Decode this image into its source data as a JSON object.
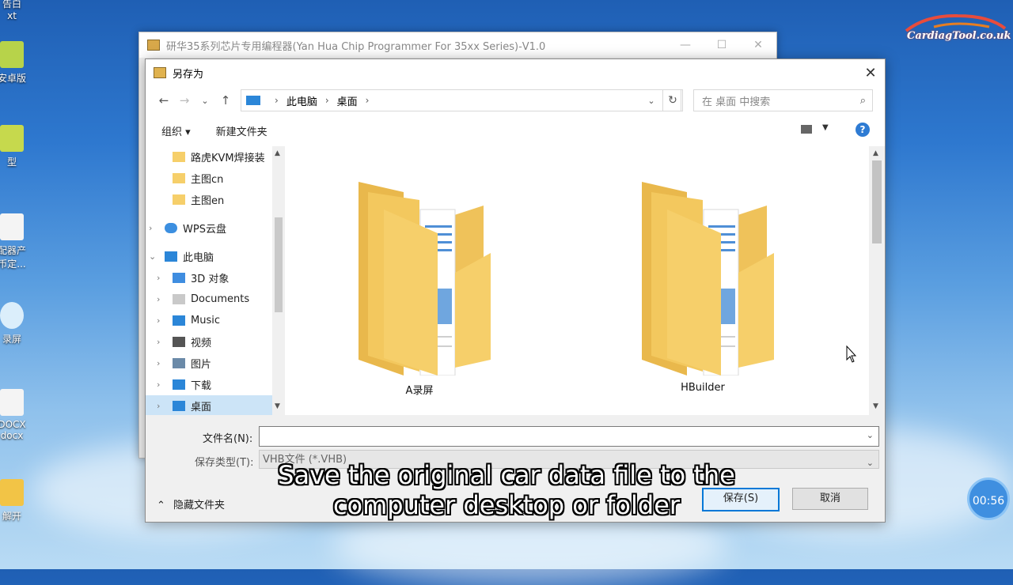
{
  "background_window": {
    "title": "研华35系列芯片专用编程器(Yan Hua Chip Programmer For 35xx Series)-V1.0",
    "controls": [
      "—",
      "☐",
      "✕"
    ]
  },
  "desktop_icons": [
    "告白",
    "xt",
    "安卓版",
    "型",
    "配器产",
    "币定...",
    "录屏",
    "DOCX",
    "docx",
    "解开"
  ],
  "dialog": {
    "title": "另存为",
    "close": "✕",
    "nav": {
      "back": "←",
      "forward": "→",
      "recent": "⌄",
      "up": "↑"
    },
    "breadcrumb": [
      "此电脑",
      "桌面"
    ],
    "breadcrumb_sep": "›",
    "address_dropdown": "⌄",
    "refresh": "↻",
    "search_placeholder": "在 桌面 中搜索",
    "search_icon": "⌕",
    "toolbar": {
      "organize": "组织 ▾",
      "new_folder": "新建文件夹",
      "view_dropdown": "▼",
      "help": "?"
    },
    "nav_pane": [
      {
        "label": "路虎KVM焊接装",
        "chevron": "",
        "icon": "folder-icon"
      },
      {
        "label": "主图cn",
        "chevron": "",
        "icon": "folder-icon"
      },
      {
        "label": "主图en",
        "chevron": "",
        "icon": "folder-icon"
      },
      {
        "label": "WPS云盘",
        "chevron": "›",
        "icon": "cloud-icon"
      },
      {
        "label": "此电脑",
        "chevron": "⌄",
        "icon": "pc-icon"
      },
      {
        "label": "3D 对象",
        "chevron": "›",
        "icon": "3d-icon"
      },
      {
        "label": "Documents",
        "chevron": "›",
        "icon": "document-icon"
      },
      {
        "label": "Music",
        "chevron": "›",
        "icon": "music-icon"
      },
      {
        "label": "视频",
        "chevron": "›",
        "icon": "video-icon"
      },
      {
        "label": "图片",
        "chevron": "›",
        "icon": "picture-icon"
      },
      {
        "label": "下载",
        "chevron": "›",
        "icon": "download-icon"
      },
      {
        "label": "桌面",
        "chevron": "›",
        "icon": "desktop-icon",
        "selected": true
      }
    ],
    "nav_scroll": {
      "up": "▲",
      "down": "▼"
    },
    "content_scroll": {
      "up": "▲",
      "down": "▼"
    },
    "files": [
      {
        "name": "A录屏"
      },
      {
        "name": "HBuilder"
      }
    ],
    "filename_label": "文件名(N):",
    "filename_value": "",
    "filetype_label": "保存类型(T):",
    "filetype_value": "VHB文件 (*.VHB)",
    "dropdown": "⌄",
    "hide_folders": "隐藏文件夹",
    "hide_chevron": "⌃",
    "save_button": "保存(S)",
    "cancel_button": "取消"
  },
  "subtitle_lines": [
    "Save the original car data file to the",
    "computer desktop or folder"
  ],
  "timer": "00:56",
  "logo_text": "CardiagTool.co.uk",
  "colors": {
    "accent": "#0078d7",
    "folder": "#f6cf6a",
    "selected": "#cce4f7"
  }
}
